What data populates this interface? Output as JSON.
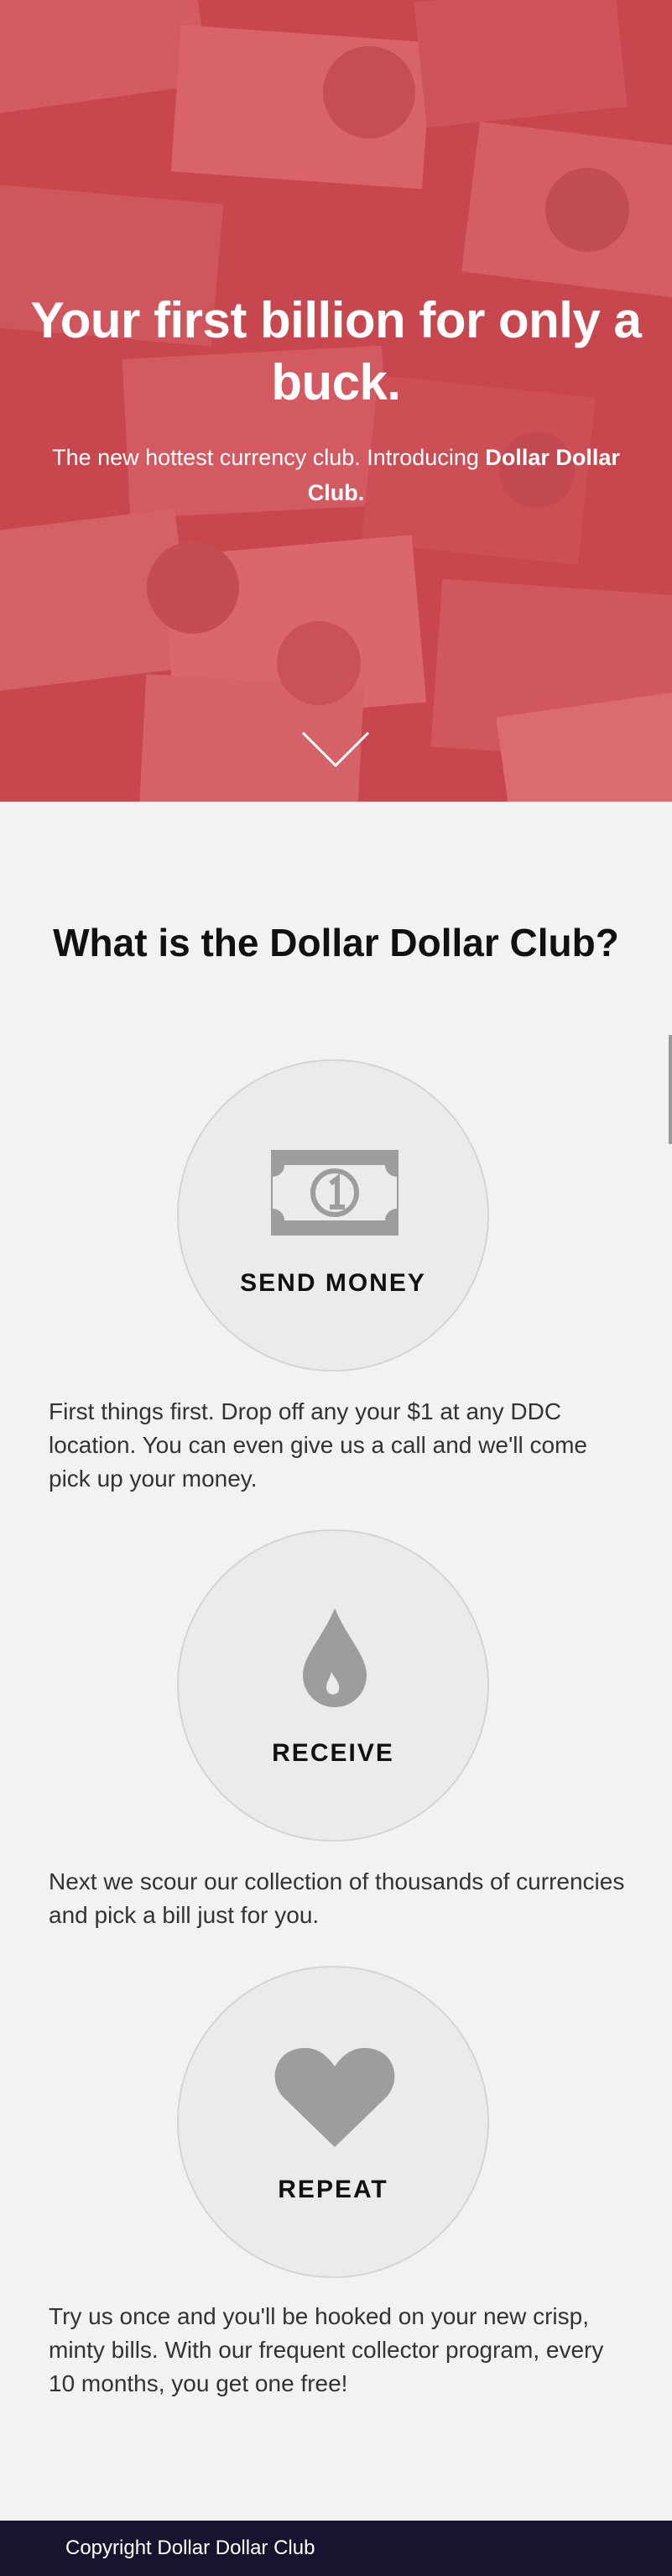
{
  "hero": {
    "title": "Your first billion for only a buck.",
    "subtitle_pre": "The new hottest currency club. Introducing ",
    "subtitle_bold": "Dollar Dollar Club.",
    "scroll_icon": "chevron-down-icon"
  },
  "about": {
    "title": "What is the Dollar Dollar Club?",
    "steps": [
      {
        "icon": "dollar-bill-icon",
        "label": "SEND MONEY",
        "text": "First things first. Drop off any your $1 at any DDC location. You can even give us a call and we'll come pick up your money."
      },
      {
        "icon": "drop-icon",
        "label": "RECEIVE",
        "text": "Next we scour our collection of thousands of currencies and pick a bill just for you."
      },
      {
        "icon": "heart-icon",
        "label": "REPEAT",
        "text": "Try us once and you'll be hooked on your new crisp, minty bills. With our frequent collector program, every 10 months, you get one free!"
      }
    ]
  },
  "footer": {
    "text": "Copyright Dollar Dollar Club"
  },
  "colors": {
    "hero_tint": "#d6464e",
    "page_bg": "#f2f2f2",
    "icon_gray": "#9d9d9d",
    "footer_bg": "#171430"
  }
}
